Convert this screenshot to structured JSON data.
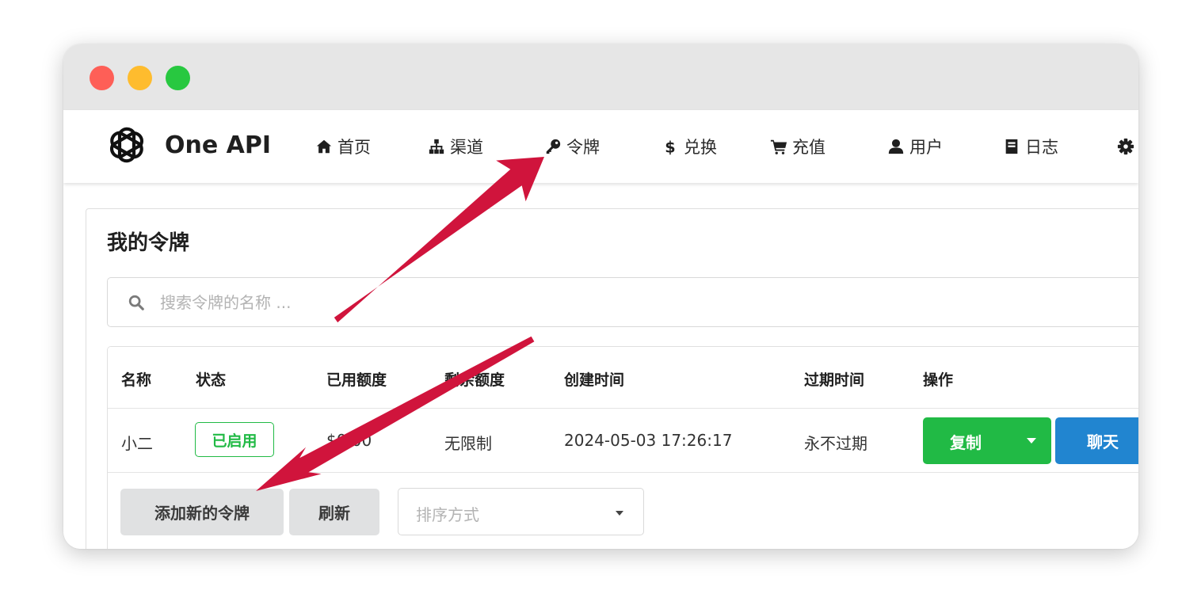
{
  "app": {
    "brand": "One API"
  },
  "nav": {
    "items": [
      {
        "label": "首页",
        "icon": "home-icon"
      },
      {
        "label": "渠道",
        "icon": "sitemap-icon"
      },
      {
        "label": "令牌",
        "icon": "key-icon"
      },
      {
        "label": "兑换",
        "icon": "dollar-icon"
      },
      {
        "label": "充值",
        "icon": "cart-icon"
      },
      {
        "label": "用户",
        "icon": "user-icon"
      },
      {
        "label": "日志",
        "icon": "book-icon"
      },
      {
        "label": "",
        "icon": "gear-icon"
      }
    ]
  },
  "page": {
    "title": "我的令牌"
  },
  "search": {
    "placeholder": "搜索令牌的名称 ..."
  },
  "table": {
    "headers": [
      "名称",
      "状态",
      "已用额度",
      "剩余额度",
      "创建时间",
      "过期时间",
      "操作"
    ],
    "rows": [
      {
        "name": "小二",
        "status": "已启用",
        "used": "$0.00",
        "remaining": "无限制",
        "created": "2024-05-03 17:26:17",
        "expires": "永不过期",
        "copy_label": "复制",
        "chat_label": "聊天"
      }
    ]
  },
  "footer": {
    "add_label": "添加新的令牌",
    "refresh_label": "刷新",
    "sort_placeholder": "排序方式"
  },
  "colors": {
    "accent_green": "#21ba45",
    "accent_blue": "#2185d0",
    "annotation_arrow": "#d0143c",
    "traffic_red": "#fe5f57",
    "traffic_yellow": "#febc2e",
    "traffic_green": "#28c840"
  }
}
